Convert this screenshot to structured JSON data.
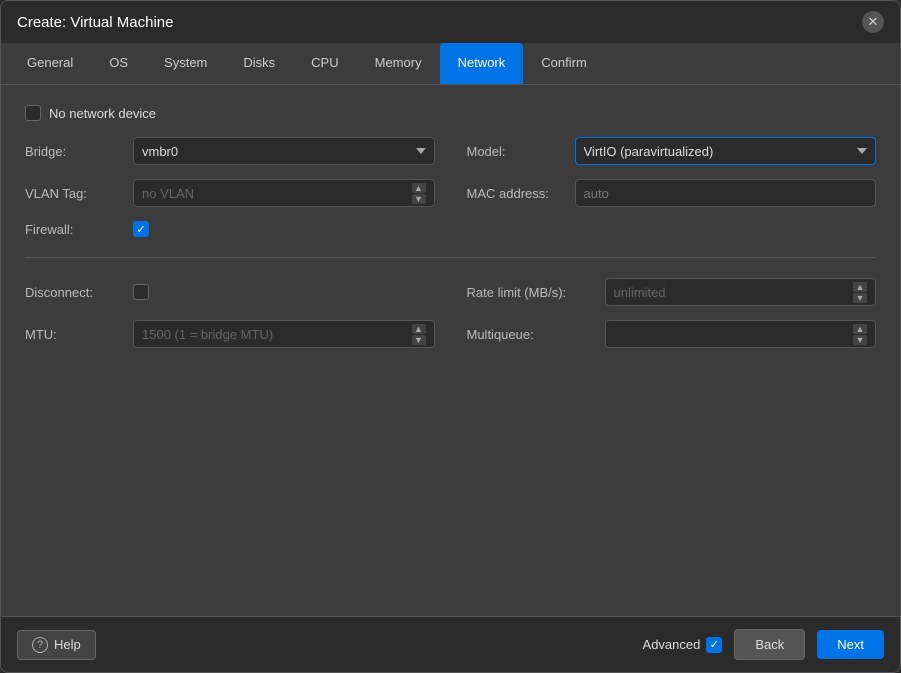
{
  "dialog": {
    "title": "Create: Virtual Machine"
  },
  "tabs": [
    {
      "id": "general",
      "label": "General",
      "active": false
    },
    {
      "id": "os",
      "label": "OS",
      "active": false
    },
    {
      "id": "system",
      "label": "System",
      "active": false
    },
    {
      "id": "disks",
      "label": "Disks",
      "active": false
    },
    {
      "id": "cpu",
      "label": "CPU",
      "active": false
    },
    {
      "id": "memory",
      "label": "Memory",
      "active": false
    },
    {
      "id": "network",
      "label": "Network",
      "active": true
    },
    {
      "id": "confirm",
      "label": "Confirm",
      "active": false
    }
  ],
  "form": {
    "no_network_label": "No network device",
    "bridge_label": "Bridge:",
    "bridge_value": "vmbr0",
    "vlan_tag_label": "VLAN Tag:",
    "vlan_tag_placeholder": "no VLAN",
    "firewall_label": "Firewall:",
    "firewall_checked": true,
    "model_label": "Model:",
    "model_value": "VirtIO (paravirtualized)",
    "mac_address_label": "MAC address:",
    "mac_address_placeholder": "auto",
    "disconnect_label": "Disconnect:",
    "disconnect_checked": false,
    "rate_limit_label": "Rate limit (MB/s):",
    "rate_limit_placeholder": "unlimited",
    "mtu_label": "MTU:",
    "mtu_placeholder": "1500 (1 = bridge MTU)",
    "multiqueue_label": "Multiqueue:"
  },
  "footer": {
    "help_label": "Help",
    "advanced_label": "Advanced",
    "advanced_checked": true,
    "back_label": "Back",
    "next_label": "Next"
  },
  "icons": {
    "close": "✕",
    "help": "?",
    "check": "✓",
    "arrow_up": "▲",
    "arrow_down": "▼"
  }
}
